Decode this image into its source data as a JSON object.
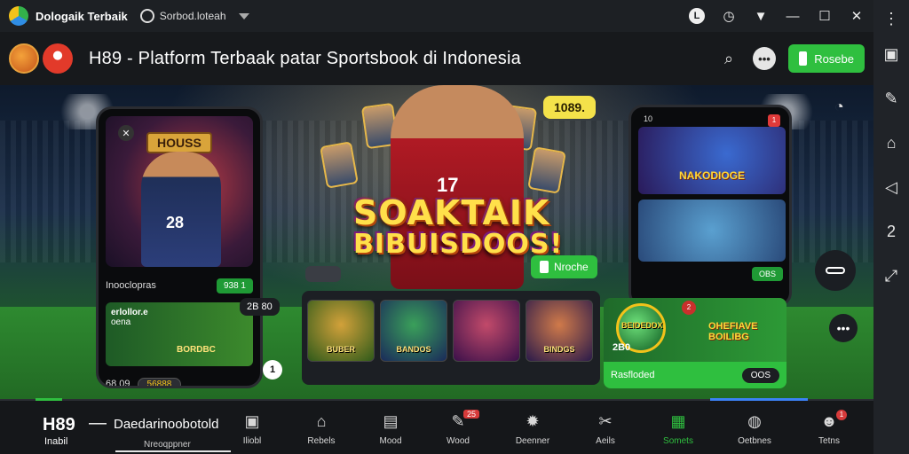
{
  "system_bar": {
    "app_name": "Dologaik Terbaik",
    "sub_name": "Sorbod.loteah",
    "icons": [
      "record-icon",
      "clock-icon",
      "wifi-icon",
      "minimize-icon",
      "maximize-icon",
      "close-icon"
    ],
    "record_glyph": "L",
    "clock_glyph": "◷"
  },
  "header": {
    "title": "H89 - Platform Terbaak patar Sportsbook di Indonesia",
    "action_button": "Rosebe",
    "chat_glyph": "•••"
  },
  "hero": {
    "left_phone": {
      "badge": "HOUSS",
      "player_number": "28",
      "row_label": "Inooclopras",
      "row_button": "938 1",
      "card_text": "erlollor.e",
      "card_sub": "oena",
      "card_title": "BORDBC",
      "card_tag": "2B 80",
      "bottom_value": "68 09",
      "bottom_pill": "56888",
      "timer": "1"
    },
    "price_bubble": "1089.",
    "banner_title": "SOAKTAIK",
    "banner_sub": "BIBUISDOOS!",
    "player_number": "17",
    "cta_chip": "Nroche",
    "tiles": [
      "BUBER",
      "BANDOS",
      "",
      "BINDGS"
    ],
    "right_phone": {
      "top_tag": "10",
      "badge": "1",
      "tile_title": "NAKODIOGE",
      "button": "OBS"
    },
    "right_card": {
      "name_left": "BEIDEDDX",
      "name_right": "OHEFIAVE BOILIBG",
      "number": "2B0",
      "footer": "Rasfloded",
      "footer_pill": "OOS",
      "red_dot": "2"
    }
  },
  "bottom_nav": {
    "brand": "H89",
    "brand_dash": "—",
    "brand_sub": "Inabil",
    "site": "Daedarinoobotold",
    "site_sub": "Nreoqppner",
    "items": [
      {
        "label": "Iliobl",
        "icon": "box-icon",
        "glyph": "▣"
      },
      {
        "label": "Rebels",
        "icon": "home-icon",
        "glyph": "⌂"
      },
      {
        "label": "Mood",
        "icon": "card-icon",
        "glyph": "▤"
      },
      {
        "label": "Wood",
        "icon": "pen-icon",
        "glyph": "✎",
        "badge": "25"
      },
      {
        "label": "Deenner",
        "icon": "gear-icon",
        "glyph": "✹"
      },
      {
        "label": "Aeils",
        "icon": "tools-icon",
        "glyph": "✂"
      },
      {
        "label": "Somets",
        "icon": "grid-icon",
        "glyph": "▦",
        "active": true
      },
      {
        "label": "Oetbnes",
        "icon": "disc-icon",
        "glyph": "◍"
      },
      {
        "label": "Tetns",
        "icon": "user-icon",
        "glyph": "☻",
        "dot": "1"
      }
    ]
  },
  "side_rail": {
    "icons": [
      "more-vert-icon",
      "screenshot-icon",
      "edit-icon",
      "home-icon",
      "back-icon",
      "scale-icon",
      "expand-icon"
    ],
    "glyphs": [
      "⋮",
      "▣",
      "✎",
      "⌂",
      "◁",
      "2",
      "⤢"
    ]
  },
  "colors": {
    "accent_green": "#2fbf3f",
    "banner_yellow": "#ffe04a",
    "header_bg": "#17191c"
  }
}
